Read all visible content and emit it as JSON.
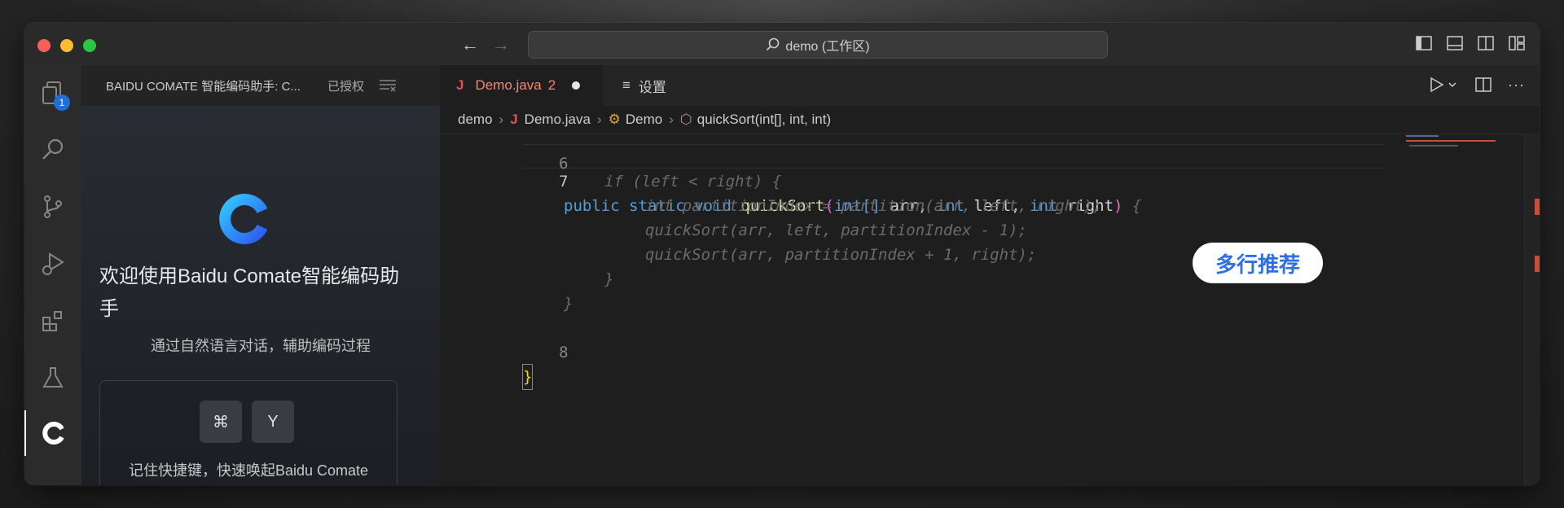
{
  "window": {
    "search_text": "demo (工作区)"
  },
  "activity_bar": {
    "explorer_badge": "1"
  },
  "sidebar": {
    "header_title": "BAIDU COMATE 智能编码助手: C...",
    "header_auth": "已授权",
    "welcome_title": "欢迎使用Baidu Comate智能编码助手",
    "subtitle": "通过自然语言对话，辅助编码过程",
    "shortcut_key1": "⌘",
    "shortcut_key2": "Y",
    "shortcut_text": "记住快捷键，快速唤起Baidu Comate"
  },
  "editor": {
    "tabs": [
      {
        "icon": "J",
        "label": "Demo.java",
        "problems": "2",
        "modified": true
      },
      {
        "label": "设置"
      }
    ],
    "breadcrumb": {
      "folder": "demo",
      "file": "Demo.java",
      "class": "Demo",
      "method": "quickSort(int[], int, int)"
    },
    "line_numbers": [
      "6",
      "7",
      "8"
    ],
    "code": {
      "line7": {
        "kw1": "public",
        "kw2": "static",
        "kw3": "void",
        "fn": "quickSort",
        "p_open": "(",
        "t1": "int[]",
        "a1": " arr, ",
        "t2": "int",
        "a2": " left, ",
        "t3": "int",
        "a3": " right",
        "p_close": ")",
        "tail": " {"
      },
      "ghost_lines": [
        "if (left < right) {",
        "int partitionIndex = partition(arr, left, right);",
        "quickSort(arr, left, partitionIndex - 1);",
        "quickSort(arr, partitionIndex + 1, right);",
        "}",
        "}"
      ],
      "line8": "}"
    },
    "suggestion_bubble": "多行推荐"
  }
}
